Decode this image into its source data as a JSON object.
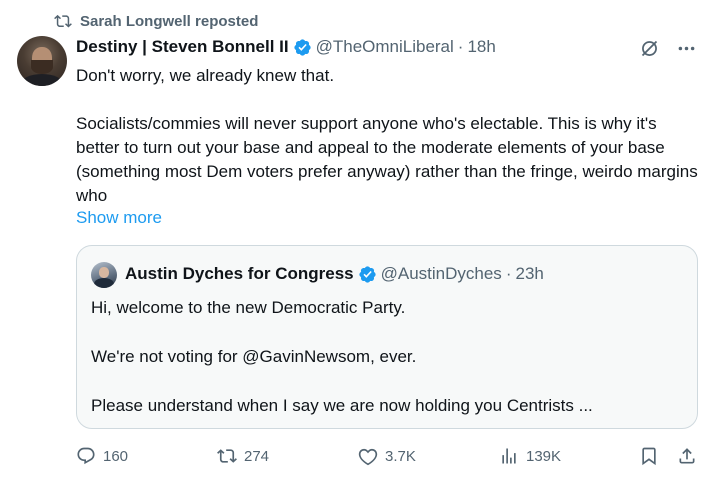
{
  "repost": {
    "label": "Sarah Longwell reposted",
    "icon": "repost-icon"
  },
  "tweet": {
    "author_name": "Destiny | Steven Bonnell II",
    "handle": "@TheOmniLiberal",
    "separator": "·",
    "time": "18h",
    "text_lines": [
      "Don't worry, we already knew that.",
      "Socialists/commies will never support anyone who's electable. This is why it's better to turn out your base and appeal to the moderate elements of your base (something most Dem voters prefer anyway) rather than the fringe, weirdo margins who"
    ],
    "show_more": "Show more"
  },
  "quote": {
    "author_name": "Austin Dyches for Congress",
    "handle": "@AustinDyches",
    "separator": "·",
    "time": "23h",
    "lines": [
      "Hi, welcome to the new Democratic Party.",
      "We're not voting for @GavinNewsom, ever.",
      "Please understand when I say we are now holding you Centrists ..."
    ]
  },
  "actions": {
    "replies": "160",
    "reposts": "274",
    "likes": "3.7K",
    "views": "139K"
  },
  "colors": {
    "accent": "#1d9bf0",
    "muted": "#536471",
    "text": "#0f1419",
    "border": "#cfd9de",
    "quote_bg": "#f7f9f9"
  }
}
